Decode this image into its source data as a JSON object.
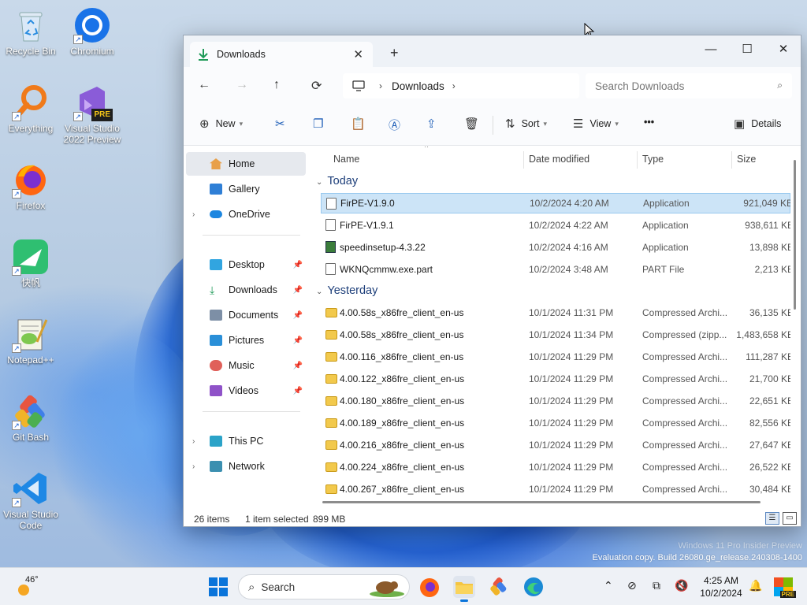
{
  "desktop": {
    "icons": [
      {
        "label": "Recycle Bin"
      },
      {
        "label": "Chromium"
      },
      {
        "label": "Everything"
      },
      {
        "label": "Visual Studio 2022 Preview",
        "badge": "PRE"
      },
      {
        "label": "Firefox"
      },
      {
        "label": "快帆"
      },
      {
        "label": "Notepad++"
      },
      {
        "label": "Git Bash"
      },
      {
        "label": "Visual Studio Code"
      }
    ],
    "watermark_line1": "Windows 11 Pro Insider Preview",
    "watermark_line2": "Evaluation copy. Build 26080.ge_release.240308-1400"
  },
  "window": {
    "tab_title": "Downloads",
    "address": {
      "crumb": "Downloads"
    },
    "search": {
      "placeholder": "Search Downloads"
    },
    "toolbar": {
      "new_label": "New",
      "sort_label": "Sort",
      "view_label": "View",
      "more_label": "•••",
      "details_label": "Details"
    },
    "sidebar": {
      "home": "Home",
      "gallery": "Gallery",
      "onedrive": "OneDrive",
      "desktop": "Desktop",
      "downloads": "Downloads",
      "documents": "Documents",
      "pictures": "Pictures",
      "music": "Music",
      "videos": "Videos",
      "thispc": "This PC",
      "network": "Network"
    },
    "columns": {
      "name": "Name",
      "date": "Date modified",
      "type": "Type",
      "size": "Size"
    },
    "groups": {
      "today": "Today",
      "yesterday": "Yesterday"
    },
    "today_rows": [
      {
        "name": "FirPE-V1.9.0",
        "date": "10/2/2024 4:20 AM",
        "type": "Application",
        "size": "921,049 KB"
      },
      {
        "name": "FirPE-V1.9.1",
        "date": "10/2/2024 4:22 AM",
        "type": "Application",
        "size": "938,611 KB"
      },
      {
        "name": "speedinsetup-4.3.22",
        "date": "10/2/2024 4:16 AM",
        "type": "Application",
        "size": "13,898 KB"
      },
      {
        "name": "WKNQcmmw.exe.part",
        "date": "10/2/2024 3:48 AM",
        "type": "PART File",
        "size": "2,213 KB"
      }
    ],
    "yesterday_rows": [
      {
        "name": "4.00.58s_x86fre_client_en-us",
        "date": "10/1/2024 11:31 PM",
        "type": "Compressed Archi...",
        "size": "36,135 KB"
      },
      {
        "name": "4.00.58s_x86fre_client_en-us",
        "date": "10/1/2024 11:34 PM",
        "type": "Compressed (zipp...",
        "size": "1,483,658 KB"
      },
      {
        "name": "4.00.116_x86fre_client_en-us",
        "date": "10/1/2024 11:29 PM",
        "type": "Compressed Archi...",
        "size": "111,287 KB"
      },
      {
        "name": "4.00.122_x86fre_client_en-us",
        "date": "10/1/2024 11:29 PM",
        "type": "Compressed Archi...",
        "size": "21,700 KB"
      },
      {
        "name": "4.00.180_x86fre_client_en-us",
        "date": "10/1/2024 11:29 PM",
        "type": "Compressed Archi...",
        "size": "22,651 KB"
      },
      {
        "name": "4.00.189_x86fre_client_en-us",
        "date": "10/1/2024 11:29 PM",
        "type": "Compressed Archi...",
        "size": "82,556 KB"
      },
      {
        "name": "4.00.216_x86fre_client_en-us",
        "date": "10/1/2024 11:29 PM",
        "type": "Compressed Archi...",
        "size": "27,647 KB"
      },
      {
        "name": "4.00.224_x86fre_client_en-us",
        "date": "10/1/2024 11:29 PM",
        "type": "Compressed Archi...",
        "size": "26,522 KB"
      },
      {
        "name": "4.00.267_x86fre_client_en-us",
        "date": "10/1/2024 11:29 PM",
        "type": "Compressed Archi...",
        "size": "30,484 KB"
      }
    ],
    "status": {
      "count": "26 items",
      "selected": "1 item selected",
      "size": "899 MB"
    }
  },
  "taskbar": {
    "weather_temp": "46°",
    "search_label": "Search",
    "time": "4:25 AM",
    "date": "10/2/2024",
    "badge": "PRE"
  }
}
